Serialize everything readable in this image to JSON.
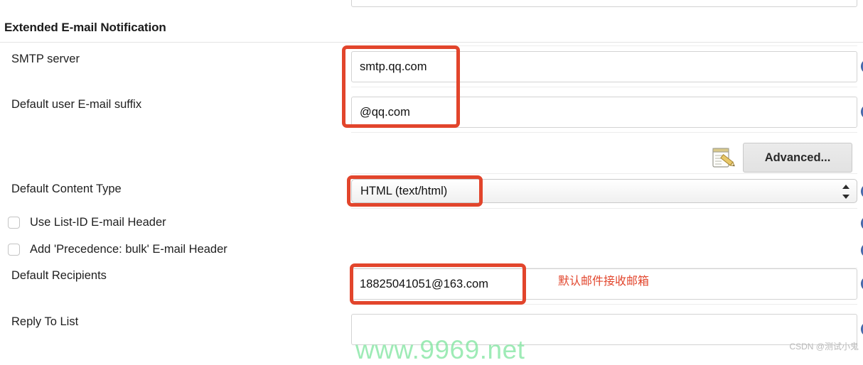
{
  "section": {
    "title": "Extended E-mail Notification"
  },
  "rows": {
    "smtp_server": {
      "label": "SMTP server",
      "value": "smtp.qq.com",
      "placeholder": ""
    },
    "email_suffix": {
      "label": "Default user E-mail suffix",
      "value": "@qq.com",
      "placeholder": ""
    },
    "content_type": {
      "label": "Default Content Type",
      "value": "HTML (text/html)"
    },
    "use_list_id": {
      "label": "Use List-ID E-mail Header",
      "checked": false
    },
    "precedence_bulk": {
      "label": "Add 'Precedence: bulk' E-mail Header",
      "checked": false
    },
    "default_recipients": {
      "label": "Default Recipients",
      "value": "18825041051@163.com",
      "placeholder": ""
    },
    "reply_to_list": {
      "label": "Reply To List",
      "value": "",
      "placeholder": ""
    }
  },
  "toolbar": {
    "advanced_label": "Advanced...",
    "notepad_icon": "notepad-pencil-icon"
  },
  "annotations": {
    "recipients_note": "默认邮件接收邮箱",
    "highlight_color": "#e2452c"
  },
  "watermarks": {
    "green": "www.9969.net",
    "csdn": "CSDN @测试小鬼"
  },
  "icons": {
    "help": "help-circle-icon",
    "stepper": "select-stepper-icon"
  }
}
